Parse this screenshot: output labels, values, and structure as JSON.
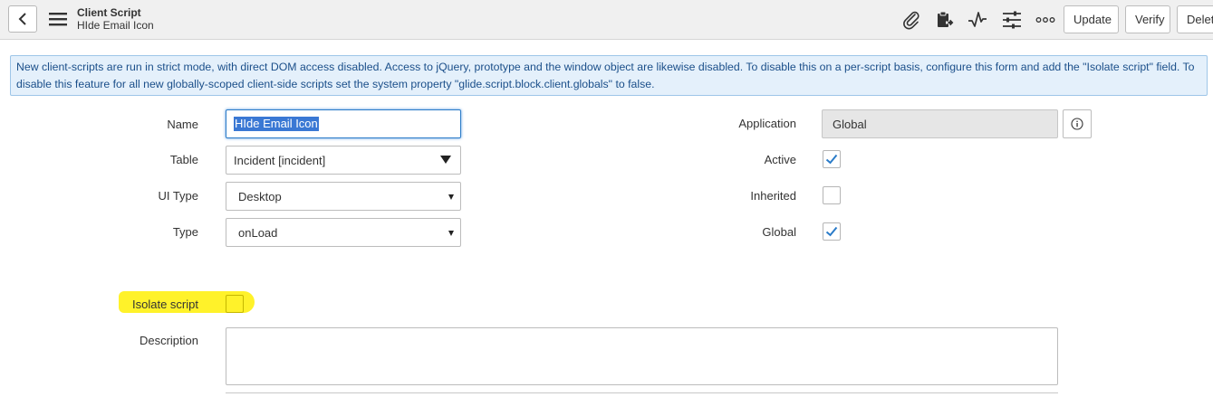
{
  "header": {
    "record_type": "Client Script",
    "record_name": "HIde Email Icon",
    "icons": [
      "back-icon",
      "menu-icon",
      "attachment-icon",
      "clipboard-icon",
      "activity-icon",
      "settings-sliders-icon",
      "more-icon"
    ],
    "buttons": {
      "update": "Update",
      "verify": "Verify",
      "delete": "Delet"
    }
  },
  "banner": {
    "text": "New client-scripts are run in strict mode, with direct DOM access disabled. Access to jQuery, prototype and the window object are likewise disabled. To disable this on a per-script basis, configure this form and add the \"Isolate script\" field. To disable this feature for all new globally-scoped client-side scripts set the system property \"glide.script.block.client.globals\" to false."
  },
  "form": {
    "name_label": "Name",
    "name_value": "HIde Email Icon",
    "table_label": "Table",
    "table_value": "Incident [incident]",
    "ui_type_label": "UI Type",
    "ui_type_value": "Desktop",
    "type_label": "Type",
    "type_value": "onLoad",
    "application_label": "Application",
    "application_value": "Global",
    "active_label": "Active",
    "active_checked": true,
    "inherited_label": "Inherited",
    "inherited_checked": false,
    "global_label": "Global",
    "global_checked": true,
    "isolate_label": "Isolate script",
    "isolate_checked": false,
    "description_label": "Description",
    "description_value": ""
  },
  "colors": {
    "accent": "#2a7bc8",
    "banner_bg": "#e4f0fb",
    "highlight": "#fff22a",
    "selection": "#3a78d4"
  }
}
